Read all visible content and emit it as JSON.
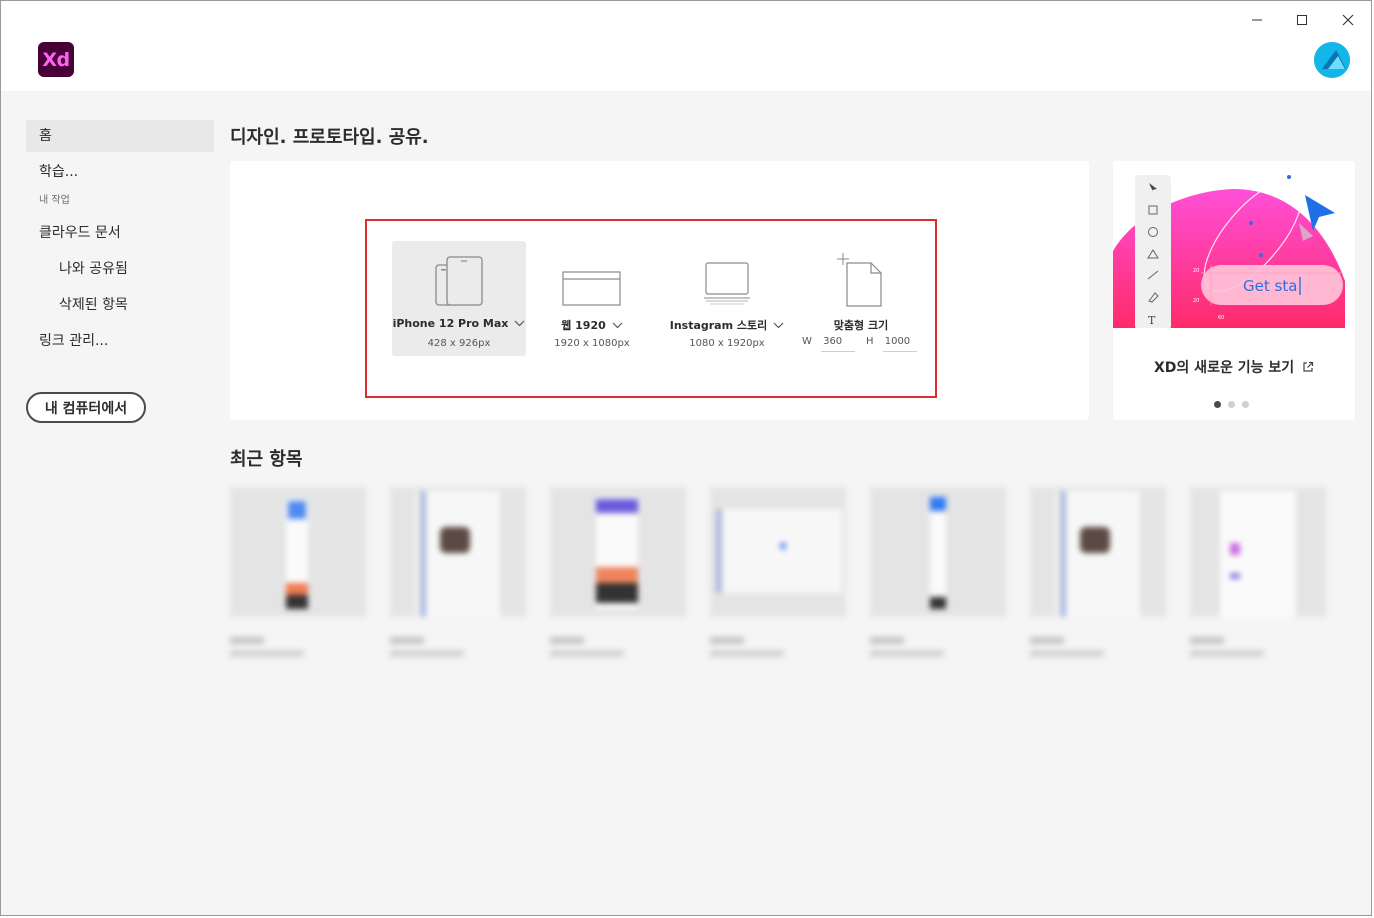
{
  "app": {
    "logo_text": "Xd",
    "brand_color": "#470137",
    "logo_text_color": "#ff61f6"
  },
  "window_controls": {
    "minimize": "minimize-icon",
    "maximize": "maximize-icon",
    "close": "close-icon"
  },
  "sidebar": {
    "items": [
      {
        "label": "홈",
        "active": true
      },
      {
        "label": "학습..."
      }
    ],
    "section_label": "내 작업",
    "work_items": [
      {
        "label": "클라우드 문서"
      },
      {
        "label": "나와 공유됨"
      },
      {
        "label": "삭제된 항목"
      },
      {
        "label": "링크 관리..."
      }
    ],
    "computer_button": "내 컴퓨터에서"
  },
  "main": {
    "heading": "디자인. 프로토타입. 공유.",
    "presets": [
      {
        "label": "iPhone 12 Pro Max",
        "size": "428 x 926px",
        "icon": "phone-tablet-icon",
        "has_dropdown": true,
        "selected": true
      },
      {
        "label": "웹 1920",
        "size": "1920 x 1080px",
        "icon": "browser-window-icon",
        "has_dropdown": true
      },
      {
        "label": "Instagram 스토리",
        "size": "1080 x 1920px",
        "icon": "instagram-story-icon",
        "has_dropdown": true
      }
    ],
    "custom_size": {
      "label": "맞춤형 크기",
      "width_label": "W",
      "width_value": "360",
      "height_label": "H",
      "height_value": "1000"
    },
    "highlight_color": "#e02c2c",
    "promo": {
      "title": "XD의 새로운 기능 보기",
      "button_text": "Get sta",
      "tool_icons": [
        "select-icon",
        "rectangle-icon",
        "ellipse-icon",
        "triangle-icon",
        "line-icon",
        "pen-icon",
        "text-icon"
      ],
      "active_slide": 1,
      "slide_count": 3
    },
    "recent_heading": "최근 항목",
    "recent_count": 7
  }
}
